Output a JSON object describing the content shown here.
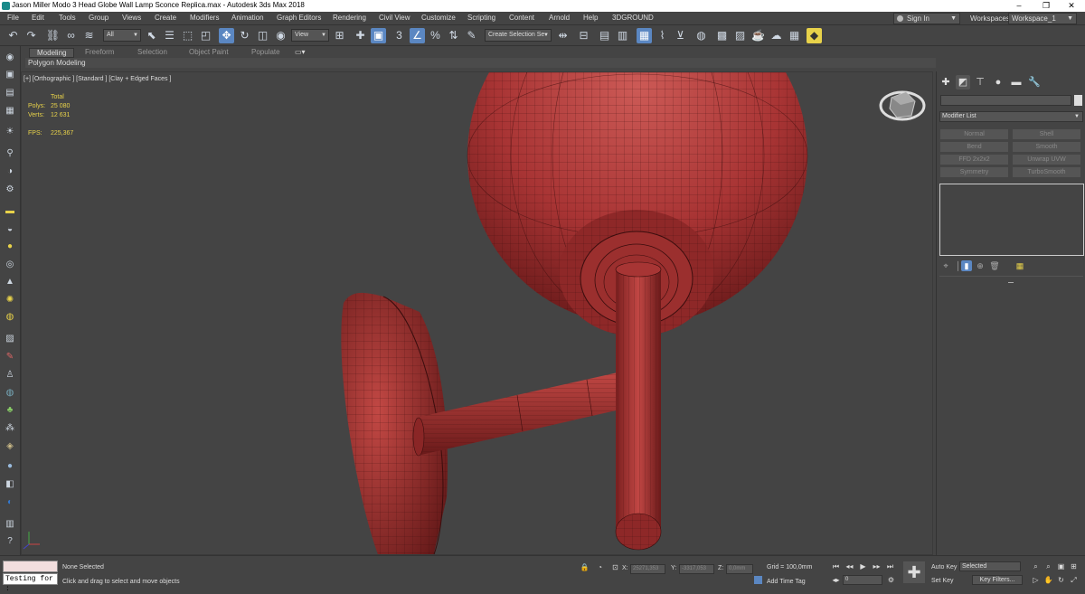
{
  "title": "Jason Miller Modo 3 Head Globe Wall Lamp Sconce Replica.max - Autodesk 3ds Max 2018",
  "window_controls": {
    "minimize": "–",
    "maximize": "❐",
    "close": "✕"
  },
  "menu": [
    "File",
    "Edit",
    "Tools",
    "Group",
    "Views",
    "Create",
    "Modifiers",
    "Animation",
    "Graph Editors",
    "Rendering",
    "Civil View",
    "Customize",
    "Scripting",
    "Content",
    "Arnold",
    "Help",
    "3DGROUND"
  ],
  "signin": "Sign In",
  "workspaces_label": "Workspaces:",
  "workspace": "Workspace_1",
  "toolbar": {
    "selection_filter": "All",
    "ref_coord": "View",
    "snap_label": "3",
    "selection_set": "Create Selection Se"
  },
  "ribbon": {
    "tabs": [
      "Modeling",
      "Freeform",
      "Selection",
      "Object Paint",
      "Populate"
    ],
    "panel": "Polygon Modeling"
  },
  "viewport": {
    "label": "[+] [Orthographic ] [Standard ] [Clay + Edged Faces ]",
    "stats": {
      "total": "Total",
      "polys_label": "Polys:",
      "polys": "25 080",
      "verts_label": "Verts:",
      "verts": "12 631",
      "fps_label": "FPS:",
      "fps": "225,367"
    }
  },
  "command_panel": {
    "modifier_list": "Modifier List",
    "modifier_buttons": [
      "Normal",
      "Shell",
      "Bend",
      "Smooth",
      "FFD 2x2x2",
      "Unwrap UVW",
      "Symmetry",
      "TurboSmooth"
    ]
  },
  "status": {
    "selection": "None Selected",
    "prompt": "Click and drag to select and move objects",
    "listener": "Testing for :",
    "x_label": "X:",
    "x": "25271,353",
    "y_label": "Y:",
    "y": "-3317,053",
    "z_label": "Z:",
    "z": "0,0mm",
    "grid": "Grid = 100,0mm",
    "add_time_tag": "Add Time Tag",
    "frame": "0",
    "auto_key": "Auto Key",
    "set_key": "Set Key",
    "key_mode": "Selected",
    "key_filters": "Key Filters..."
  },
  "colors": {
    "accent": "#5b87c2",
    "mesh": "#b8393a",
    "stats": "#e8d24a",
    "bg": "#444444"
  }
}
